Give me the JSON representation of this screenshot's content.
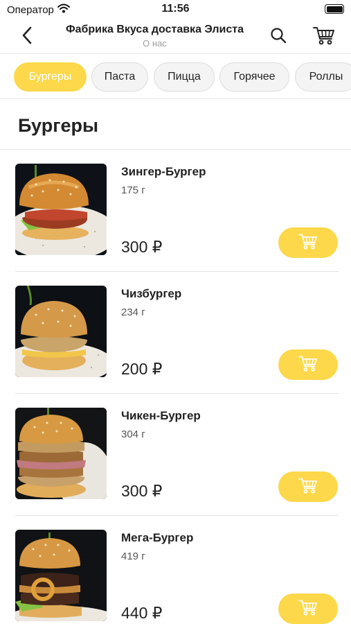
{
  "status_bar": {
    "carrier": "Оператор",
    "time": "11:56",
    "icons": [
      "wifi-icon",
      "battery-icon"
    ]
  },
  "header": {
    "title": "Фабрика Вкуса доставка Элиста",
    "subtitle": "О нас",
    "icons": [
      "chevron-left-icon",
      "search-icon",
      "cart-icon"
    ]
  },
  "categories": [
    {
      "label": "Бургеры",
      "active": true
    },
    {
      "label": "Паста",
      "active": false
    },
    {
      "label": "Пицца",
      "active": false
    },
    {
      "label": "Горячее",
      "active": false
    },
    {
      "label": "Роллы",
      "active": false
    }
  ],
  "section": {
    "title": "Бургеры"
  },
  "products": [
    {
      "name": "Зингер-Бургер",
      "weight": "175 г",
      "price": "300 ₽"
    },
    {
      "name": "Чизбургер",
      "weight": "234 г",
      "price": "200 ₽"
    },
    {
      "name": "Чикен-Бургер",
      "weight": "304 г",
      "price": "300 ₽"
    },
    {
      "name": "Мега-Бургер",
      "weight": "419 г",
      "price": "440 ₽"
    }
  ],
  "colors": {
    "accent": "#fcd84a",
    "chip_background": "#f4f4f4",
    "divider": "#e6e6e6",
    "muted_text": "#9c9c9c"
  }
}
